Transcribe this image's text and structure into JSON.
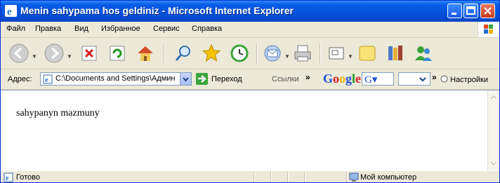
{
  "window": {
    "title": "Menin sahypama hos geldiniz - Microsoft Internet Explorer",
    "controls": [
      "minimize",
      "maximize",
      "close"
    ]
  },
  "menu": {
    "items": [
      "Файл",
      "Правка",
      "Вид",
      "Избранное",
      "Сервис",
      "Справка"
    ]
  },
  "toolbar": {
    "buttons": [
      "back-icon",
      "forward-icon",
      "stop-icon",
      "refresh-icon",
      "home-icon",
      "search-icon",
      "favorites-icon",
      "history-icon",
      "mail-icon",
      "print-icon",
      "edit-icon",
      "discuss-icon",
      "research-icon",
      "messenger-icon"
    ]
  },
  "address": {
    "label": "Адрес:",
    "value": "C:\\Documents and Settings\\Админис",
    "go_label": "Переход",
    "links_label": "Ссылки",
    "chevron": "»"
  },
  "google": {
    "logo": "Google",
    "button": "G▾",
    "settings_label": "Настройки"
  },
  "content": {
    "text": "sahypanyn mazmuny"
  },
  "status": {
    "text": "Готово",
    "zone": "Мой компьютер"
  },
  "colors": {
    "titlebar": "#0a5ce6",
    "chrome": "#ece9d8",
    "close_button": "#c43a1a",
    "google_blue": "#1f4fd6",
    "google_red": "#d42020",
    "google_yellow": "#e8b400",
    "google_green": "#229922"
  }
}
